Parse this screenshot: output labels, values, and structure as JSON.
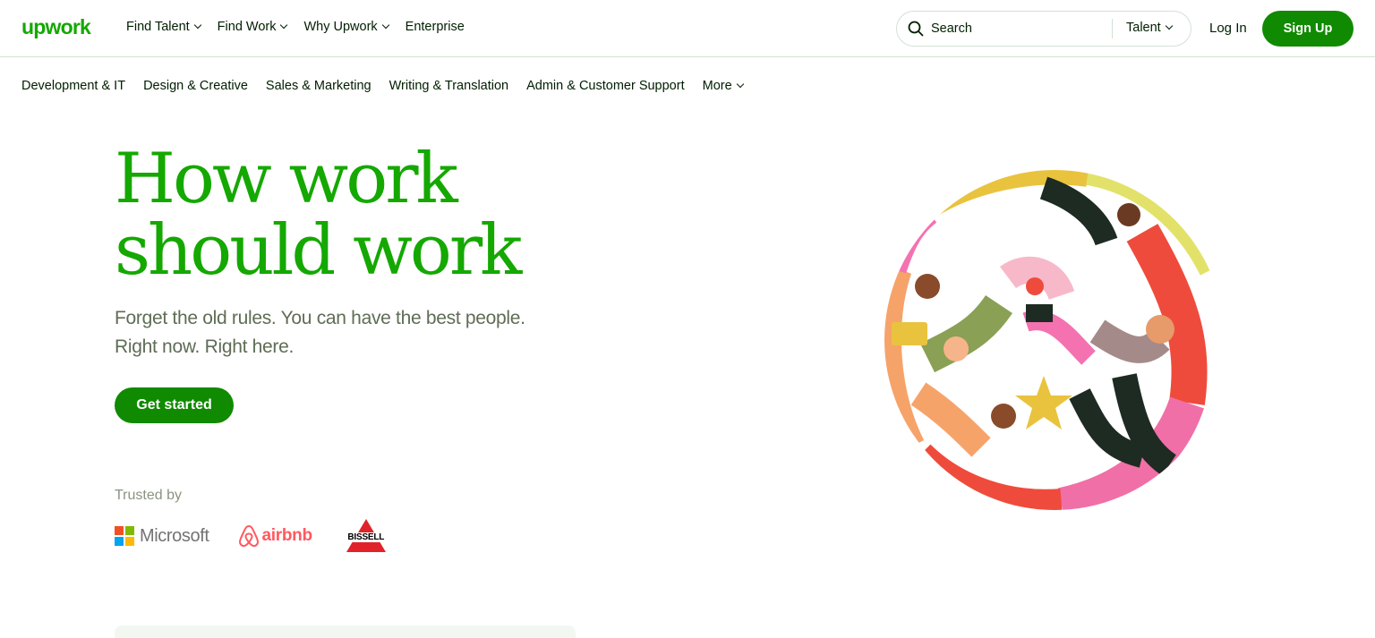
{
  "header": {
    "logo": "upwork",
    "nav": [
      {
        "label": "Find Talent",
        "has_dropdown": true
      },
      {
        "label": "Find Work",
        "has_dropdown": true
      },
      {
        "label": "Why Upwork",
        "has_dropdown": true
      },
      {
        "label": "Enterprise",
        "has_dropdown": false
      }
    ],
    "search": {
      "placeholder": "Search",
      "type_label": "Talent"
    },
    "login_label": "Log In",
    "signup_label": "Sign Up"
  },
  "categories": [
    "Development & IT",
    "Design & Creative",
    "Sales & Marketing",
    "Writing & Translation",
    "Admin & Customer Support",
    "More"
  ],
  "hero": {
    "title_line1": "How work",
    "title_line2": "should work",
    "subtitle_line1": "Forget the old rules. You can have the best people.",
    "subtitle_line2": "Right now. Right here.",
    "cta_label": "Get started"
  },
  "trusted": {
    "label": "Trusted by",
    "logos": {
      "microsoft": "Microsoft",
      "airbnb": "airbnb",
      "bissell": "BISSELL"
    }
  },
  "colors": {
    "brand_green": "#14a800",
    "button_green": "#108a00",
    "text_dark": "#001e00",
    "subtitle_gray": "#5e6d55",
    "airbnb_red": "#ff5a5f",
    "bissell_red": "#e0232b"
  },
  "icons": {
    "search": "search-icon",
    "dropdown": "chevron-down-icon"
  }
}
